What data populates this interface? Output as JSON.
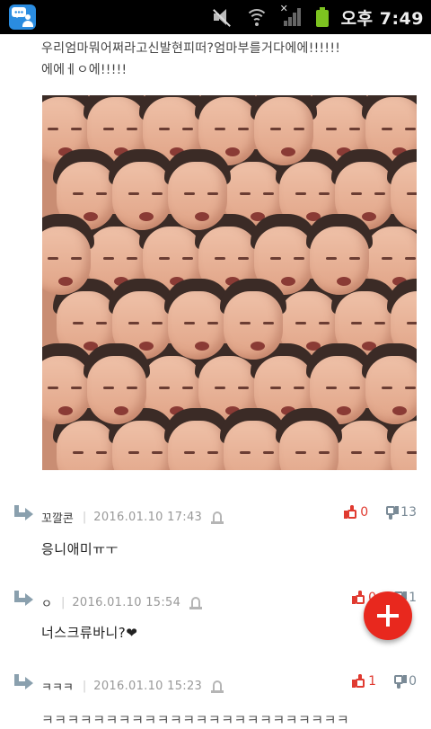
{
  "status_bar": {
    "time": "오후 7:49",
    "icons": [
      "app-message-icon",
      "mute-icon",
      "wifi-icon",
      "signal-icon",
      "battery-icon"
    ],
    "battery_color": "#7dc320"
  },
  "post": {
    "text_line1": "우리엄마뭐어쩌라고신발현피떠?엄마부를거다에에!!!!!!",
    "text_line2": "에에ㅔㅇ에!!!!!",
    "image_alt_icon": "zoom-icon"
  },
  "comments": [
    {
      "author": "꼬깔콘",
      "time": "2016.01.10 17:43",
      "body": "응니애미ㅠㅜ",
      "up": "0",
      "down": "13"
    },
    {
      "author": "ㅇ",
      "time": "2016.01.10 15:54",
      "body": "너스크류바니?❤",
      "up": "0",
      "down": "1"
    },
    {
      "author": "ㅋㅋㅋ",
      "time": "2016.01.10 15:23",
      "body": "",
      "up": "1",
      "down": "0"
    }
  ],
  "bottom_partial_text": "ㅋㅋㅋㅋㅋㅋㅋㅋㅋㅋㅋㅋㅋㅋㅋㅋㅋㅋㅋㅋㅋㅋㅋㅋ",
  "colors": {
    "accent": "#e8281e",
    "upvote": "#e03a30",
    "downvote": "#7a8a96",
    "reply_arrow": "#8aa0ae"
  }
}
